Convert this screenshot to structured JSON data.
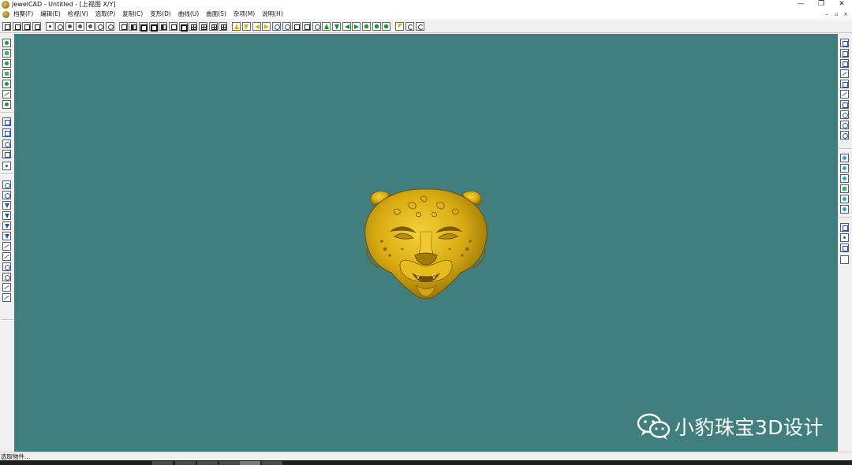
{
  "window": {
    "title": "JewelCAD - Untitled - [上视图 X/Y]",
    "controls": [
      "—",
      "❐",
      "✕"
    ],
    "mdi_controls": [
      "–",
      "▫",
      "×"
    ]
  },
  "menu": [
    {
      "label": "档案(F)"
    },
    {
      "label": "编辑(E)"
    },
    {
      "label": "检视(V)"
    },
    {
      "label": "选取(P)"
    },
    {
      "label": "复制(C)"
    },
    {
      "label": "变形(D)"
    },
    {
      "label": "曲线(U)"
    },
    {
      "label": "曲面(S)"
    },
    {
      "label": "杂项(M)"
    },
    {
      "label": "说明(H)"
    }
  ],
  "toolbar": {
    "buttons": [
      {
        "name": "new-file-icon"
      },
      {
        "name": "open-file-icon"
      },
      {
        "name": "save-icon"
      },
      {
        "name": "help-icon"
      },
      {
        "name": "crosshair-point-icon"
      },
      {
        "name": "circle-point-icon"
      },
      {
        "name": "target-point-icon"
      },
      {
        "name": "center-point-icon"
      },
      {
        "name": "fill-point-icon"
      },
      {
        "name": "ring-point-icon"
      },
      {
        "name": "sphere-point-icon"
      },
      {
        "name": "view-box-icon"
      },
      {
        "name": "view-left-icon"
      },
      {
        "name": "view-bottom-icon"
      },
      {
        "name": "view-front-icon"
      },
      {
        "name": "view-right-icon"
      },
      {
        "name": "view-top-icon"
      },
      {
        "name": "view-back-icon"
      },
      {
        "name": "split-vertical-icon"
      },
      {
        "name": "split-horizontal-icon"
      },
      {
        "name": "split-quad-icon"
      },
      {
        "name": "split-grid-icon"
      },
      {
        "name": "pan-up-icon"
      },
      {
        "name": "pan-down-icon"
      },
      {
        "name": "pan-left-icon"
      },
      {
        "name": "pan-right-icon"
      },
      {
        "name": "zoom-in-icon"
      },
      {
        "name": "zoom-out-icon"
      },
      {
        "name": "zoom-window-icon"
      },
      {
        "name": "zoom-all-icon"
      },
      {
        "name": "zoom-prev-icon"
      },
      {
        "name": "rotate-up-icon"
      },
      {
        "name": "rotate-down-icon"
      },
      {
        "name": "rotate-left-icon"
      },
      {
        "name": "rotate-right-icon"
      },
      {
        "name": "render-icon"
      },
      {
        "name": "render-gold-icon"
      },
      {
        "name": "render-shaded-icon"
      },
      {
        "name": "select-cursor-icon"
      },
      {
        "name": "undo-rotate-icon"
      },
      {
        "name": "redo-rotate-icon"
      }
    ]
  },
  "left_tools": [
    {
      "name": "curve-tool-1-icon"
    },
    {
      "name": "curve-tool-2-icon"
    },
    {
      "name": "curve-tool-3-icon"
    },
    {
      "name": "curve-tool-4-icon"
    },
    {
      "name": "curve-tool-5-icon"
    },
    {
      "name": "curve-tool-6-icon"
    },
    {
      "name": "curve-tool-7-icon"
    },
    {
      "name": "rect-tool-icon"
    },
    {
      "name": "square-tool-icon"
    },
    {
      "name": "arc-tool-icon"
    },
    {
      "name": "box-tool-icon"
    },
    {
      "name": "point-tool-icon"
    },
    {
      "name": "surface-1-icon"
    },
    {
      "name": "surface-2-icon"
    },
    {
      "name": "surface-3-icon"
    },
    {
      "name": "surface-4-icon"
    },
    {
      "name": "surface-5-icon"
    },
    {
      "name": "surface-6-icon"
    },
    {
      "name": "surface-7-icon"
    },
    {
      "name": "surface-8-icon"
    },
    {
      "name": "surface-9-icon"
    },
    {
      "name": "surface-10-icon"
    },
    {
      "name": "surface-11-icon"
    },
    {
      "name": "surface-12-icon"
    }
  ],
  "right_tools": [
    {
      "name": "edit-point-1-icon"
    },
    {
      "name": "edit-point-2-icon"
    },
    {
      "name": "edit-point-3-icon"
    },
    {
      "name": "edit-point-4-icon"
    },
    {
      "name": "edit-point-5-icon"
    },
    {
      "name": "edit-point-6-icon"
    },
    {
      "name": "edit-point-7-icon"
    },
    {
      "name": "edit-point-8-icon"
    },
    {
      "name": "edit-point-9-icon"
    },
    {
      "name": "edit-point-10-icon"
    },
    {
      "name": "gem-1-icon"
    },
    {
      "name": "gem-2-icon"
    },
    {
      "name": "gem-3-icon"
    },
    {
      "name": "gem-4-icon"
    },
    {
      "name": "gem-5-icon"
    },
    {
      "name": "gem-6-icon"
    },
    {
      "name": "misc-1-icon"
    },
    {
      "name": "misc-2-icon"
    },
    {
      "name": "misc-3-icon"
    },
    {
      "name": "misc-4-icon"
    }
  ],
  "viewport": {
    "background": "#417f7e",
    "model": "gold leopard head",
    "model_color": "#e0b315"
  },
  "watermark": {
    "text": "小豹珠宝3D设计",
    "icon": "wechat-icon"
  },
  "status": {
    "text": "选取物件..."
  }
}
